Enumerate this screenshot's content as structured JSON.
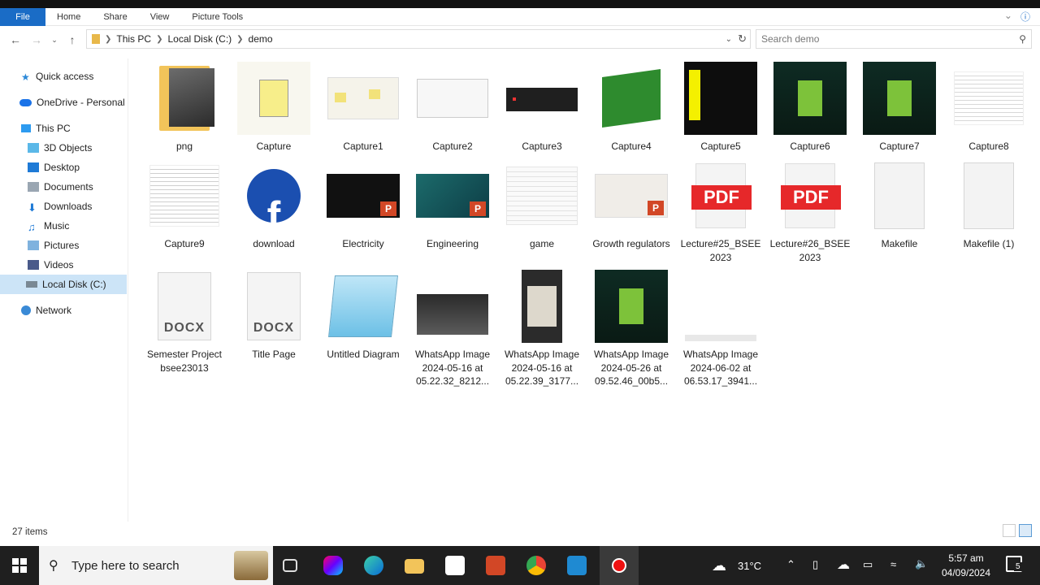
{
  "ribbon": {
    "tabs": [
      "File",
      "Home",
      "Share",
      "View",
      "Picture Tools"
    ]
  },
  "address": {
    "path": [
      "This PC",
      "Local Disk (C:)",
      "demo"
    ],
    "search_placeholder": "Search demo"
  },
  "sidebar": {
    "items": [
      {
        "label": "Quick access",
        "icon": "star-icon"
      },
      {
        "label": "OneDrive - Personal",
        "icon": "cloud-icon"
      },
      {
        "label": "This PC",
        "icon": "computer-icon"
      },
      {
        "label": "3D Objects",
        "icon": "cube-icon"
      },
      {
        "label": "Desktop",
        "icon": "desktop-icon"
      },
      {
        "label": "Documents",
        "icon": "documents-icon"
      },
      {
        "label": "Downloads",
        "icon": "downloads-icon"
      },
      {
        "label": "Music",
        "icon": "music-icon"
      },
      {
        "label": "Pictures",
        "icon": "pictures-icon"
      },
      {
        "label": "Videos",
        "icon": "videos-icon"
      },
      {
        "label": "Local Disk (C:)",
        "icon": "drive-icon"
      },
      {
        "label": "Network",
        "icon": "network-icon"
      }
    ]
  },
  "files": [
    {
      "name": "png",
      "kind": "folder"
    },
    {
      "name": "Capture",
      "kind": "image"
    },
    {
      "name": "Capture1",
      "kind": "image"
    },
    {
      "name": "Capture2",
      "kind": "image"
    },
    {
      "name": "Capture3",
      "kind": "image"
    },
    {
      "name": "Capture4",
      "kind": "image"
    },
    {
      "name": "Capture5",
      "kind": "image"
    },
    {
      "name": "Capture6",
      "kind": "image"
    },
    {
      "name": "Capture7",
      "kind": "image"
    },
    {
      "name": "Capture8",
      "kind": "image"
    },
    {
      "name": "Capture9",
      "kind": "image"
    },
    {
      "name": "download",
      "kind": "image"
    },
    {
      "name": "Electricity",
      "kind": "pptx"
    },
    {
      "name": "Engineering",
      "kind": "pptx"
    },
    {
      "name": "game",
      "kind": "image"
    },
    {
      "name": "Growth regulators",
      "kind": "pptx"
    },
    {
      "name": "Lecture#25_BSEE 2023",
      "kind": "pdf"
    },
    {
      "name": "Lecture#26_BSEE 2023",
      "kind": "pdf"
    },
    {
      "name": "Makefile",
      "kind": "file"
    },
    {
      "name": "Makefile (1)",
      "kind": "file"
    },
    {
      "name": "Semester Project bsee23013",
      "kind": "docx"
    },
    {
      "name": "Title Page",
      "kind": "docx"
    },
    {
      "name": "Untitled Diagram",
      "kind": "notepad"
    },
    {
      "name": "WhatsApp Image 2024-05-16 at 05.22.32_8212...",
      "kind": "image"
    },
    {
      "name": "WhatsApp Image 2024-05-16 at 05.22.39_3177...",
      "kind": "image"
    },
    {
      "name": "WhatsApp Image 2024-05-26 at 09.52.46_00b5...",
      "kind": "image"
    },
    {
      "name": "WhatsApp Image 2024-06-02 at 06.53.17_3941...",
      "kind": "image"
    }
  ],
  "thumb_text": {
    "pdf": "PDF",
    "docx": "DOCX",
    "pptx": "P"
  },
  "status": {
    "count": "27 items"
  },
  "taskbar": {
    "search_placeholder": "Type here to search",
    "temperature": "31°C",
    "time": "5:57 am",
    "date": "04/09/2024",
    "notifications": "5"
  }
}
